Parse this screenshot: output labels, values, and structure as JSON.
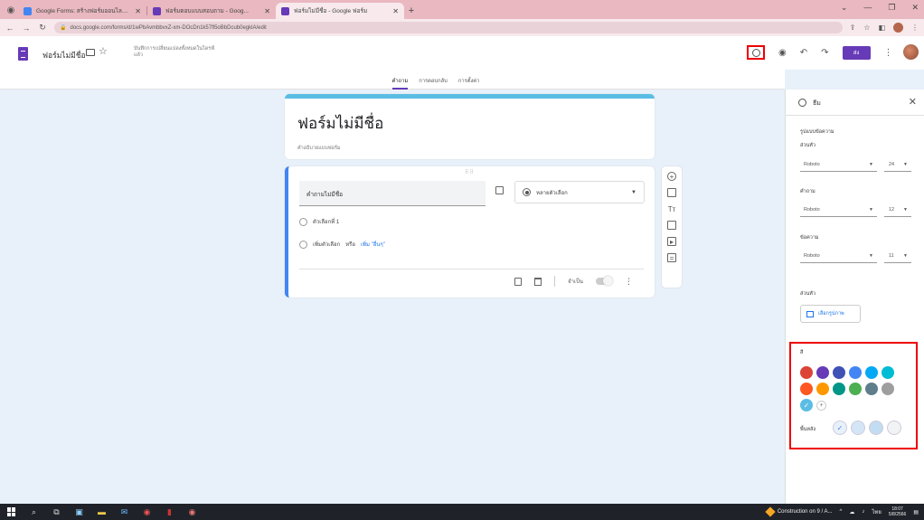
{
  "browser": {
    "tabs": [
      {
        "title": "Google Forms: สร้างฟอร์มออนไลน...",
        "favicon_color": "#4285f4",
        "active": false
      },
      {
        "title": "ฟอร์มตอบแบบสอบถาม - Goog...",
        "favicon_color": "#673ab7",
        "active": false
      },
      {
        "title": "ฟอร์มไม่มีชื่อ - Google ฟอร์ม",
        "favicon_color": "#673ab7",
        "active": true
      }
    ],
    "url": "docs.google.com/forms/d/1wPbAvmbbvxZ-xm-DOcDn1k57fl5oBbDcub0egklA/edit"
  },
  "header": {
    "doc_title": "ฟอร์มไม่มีชื่อ",
    "save_note": "บันทึกการเปลี่ยนแปลงทั้งหมดในไดรฟ์แล้ว",
    "send_label": "ส่ง"
  },
  "form_tabs": [
    "คำถาม",
    "การตอบกลับ",
    "การตั้งค่า"
  ],
  "form": {
    "title": "ฟอร์มไม่มีชื่อ",
    "description": "คำอธิบายแบบฟอร์ม",
    "question": {
      "placeholder": "คำถามไม่มีชื่อ",
      "type": "หลายตัวเลือก",
      "option1": "ตัวเลือกที่ 1",
      "add_option": "เพิ่มตัวเลือก",
      "or": "หรือ",
      "add_other": "เพิ่ม \"อื่นๆ\"",
      "required_label": "จำเป็น"
    }
  },
  "theme_panel": {
    "title": "ธีม",
    "text_style": "รูปแบบข้อความ",
    "header_label": "ส่วนหัว",
    "header_font": "Roboto",
    "header_size": "24",
    "question_label": "คำถาม",
    "question_font": "Roboto",
    "question_size": "12",
    "text_label": "ข้อความ",
    "text_font": "Roboto",
    "text_size": "11",
    "header_image_label": "ส่วนหัว",
    "choose_image": "เลือกรูปภาพ",
    "color_label": "สี",
    "background_label": "พื้นหลัง",
    "colors": [
      "#db4437",
      "#673ab7",
      "#3f51b5",
      "#4285f4",
      "#03a9f4",
      "#00bcd4",
      "#ff5722",
      "#ff9800",
      "#009688",
      "#4caf50",
      "#607d8b",
      "#9e9e9e"
    ],
    "selected_color": "#5bbde4",
    "bg_colors": [
      "#e8f1fa",
      "#d4e6f6",
      "#c2dcf2",
      "#f1f3f4"
    ]
  },
  "taskbar": {
    "notification": "Construction on 9 / A...",
    "lang": "ไทย",
    "time": "18:07",
    "date": "5/8/2566"
  }
}
